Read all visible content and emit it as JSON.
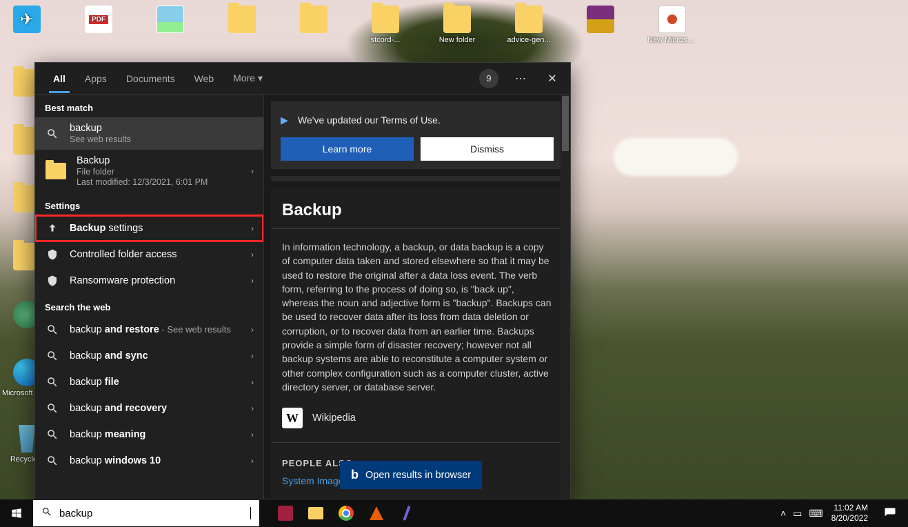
{
  "desktop": {
    "row_icons": [
      {
        "name": "telegram",
        "label": ""
      },
      {
        "name": "pdf",
        "label": ""
      },
      {
        "name": "picture",
        "label": ""
      },
      {
        "name": "folder1",
        "label": ""
      },
      {
        "name": "folder2",
        "label": ""
      },
      {
        "name": "folder3",
        "label": "stcord-..."
      },
      {
        "name": "folder4",
        "label": "New folder"
      },
      {
        "name": "folder5",
        "label": "advice-gen..."
      },
      {
        "name": "winrar",
        "label": ""
      },
      {
        "name": "ppt",
        "label": "New Microsoft..."
      }
    ],
    "left_icons": [
      {
        "name": "folder",
        "label": ""
      },
      {
        "name": "folder",
        "label": ""
      },
      {
        "name": "folder",
        "label": ""
      },
      {
        "name": "folder",
        "label": ""
      },
      {
        "name": "atom",
        "label": ""
      },
      {
        "name": "edge",
        "label": "Microsoft Edge"
      },
      {
        "name": "recycle",
        "label": "Recycle..."
      }
    ]
  },
  "search": {
    "tabs": {
      "all": "All",
      "apps": "Apps",
      "documents": "Documents",
      "web": "Web",
      "more": "More"
    },
    "badge": "9",
    "left": {
      "best_match": "Best match",
      "bm_title": "backup",
      "bm_sub": "See web results",
      "folder": {
        "title": "Backup",
        "type": "File folder",
        "modified": "Last modified: 12/3/2021, 6:01 PM"
      },
      "settings_header": "Settings",
      "settings": [
        {
          "label_pre": "Backup",
          "label_post": " settings"
        },
        {
          "label_pre": "",
          "label_post": "Controlled folder access"
        },
        {
          "label_pre": "",
          "label_post": "Ransomware protection"
        }
      ],
      "web_header": "Search the web",
      "web": [
        {
          "pre": "backup ",
          "bold": "and restore",
          "suffix": " - See web results"
        },
        {
          "pre": "backup ",
          "bold": "and sync",
          "suffix": ""
        },
        {
          "pre": "backup ",
          "bold": "file",
          "suffix": ""
        },
        {
          "pre": "backup ",
          "bold": "and recovery",
          "suffix": ""
        },
        {
          "pre": "backup ",
          "bold": "meaning",
          "suffix": ""
        },
        {
          "pre": "backup ",
          "bold": "windows 10",
          "suffix": ""
        }
      ]
    },
    "right": {
      "tou_text": "We've updated our Terms of Use.",
      "learn": "Learn more",
      "dismiss": "Dismiss",
      "title": "Backup",
      "definition": "In information technology, a backup, or data backup is a copy of computer data taken and stored elsewhere so that it may be used to restore the original after a data loss event. The verb form, referring to the process of doing so, is \"back up\", whereas the noun and adjective form is \"backup\". Backups can be used to recover data after its loss from data deletion or corruption, or to recover data from an earlier time. Backups provide a simple form of disaster recovery; however not all backup systems are able to reconstitute a computer system or other complex configuration such as a computer cluster, active directory server, or database server.",
      "wiki": "Wikipedia",
      "people_also": "PEOPLE ALSO",
      "people_link": "System Image",
      "open_browser": "Open results in browser"
    }
  },
  "taskbar": {
    "search_value": "backup",
    "time": "11:02 AM",
    "date": "8/20/2022"
  }
}
